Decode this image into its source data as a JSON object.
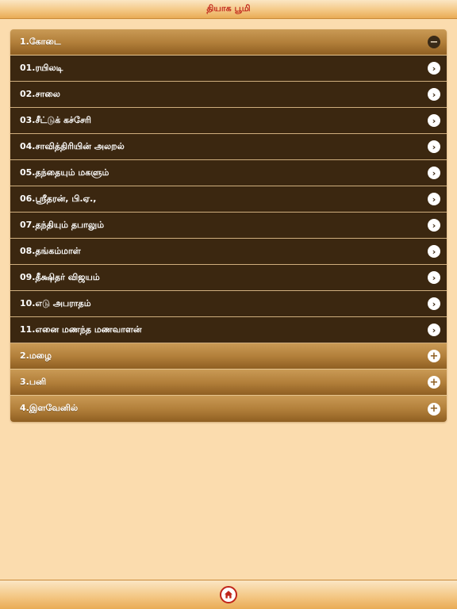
{
  "header": {
    "title": "தியாக பூமி"
  },
  "colors": {
    "title_red": "#c0251a",
    "background": "#fbdcae",
    "item_bg": "#3b2710",
    "header_gold": "#b3803b"
  },
  "sections": [
    {
      "label": "1.கோடை",
      "toggle_icon": "minus-icon",
      "expanded": true,
      "items": [
        {
          "label": "01.ரயிலடி",
          "icon": "chevron-right-icon"
        },
        {
          "label": "02.சாலை",
          "icon": "chevron-right-icon"
        },
        {
          "label": "03.சீட்டுக் கச்சேரி",
          "icon": "chevron-right-icon"
        },
        {
          "label": "04.சாவித்திரியின் அலறல்",
          "icon": "chevron-right-icon"
        },
        {
          "label": "05.தந்தையும் மகளும்",
          "icon": "chevron-right-icon"
        },
        {
          "label": "06.ஸ்ரீதரன், பி.ஏ.,",
          "icon": "chevron-right-icon"
        },
        {
          "label": "07.தந்தியும் தபாலும்",
          "icon": "chevron-right-icon"
        },
        {
          "label": "08.தங்கம்மாள்",
          "icon": "chevron-right-icon"
        },
        {
          "label": "09.தீக்ஷிதர் விஜயம்",
          "icon": "chevron-right-icon"
        },
        {
          "label": "10.எடு அபராதம்",
          "icon": "chevron-right-icon"
        },
        {
          "label": "11.எனை மணந்த மணவாளன்",
          "icon": "chevron-right-icon"
        }
      ]
    },
    {
      "label": "2.மழை",
      "toggle_icon": "plus-icon",
      "expanded": false
    },
    {
      "label": "3.பனி",
      "toggle_icon": "plus-icon",
      "expanded": false
    },
    {
      "label": "4.இளவேனில்",
      "toggle_icon": "plus-icon",
      "expanded": false
    }
  ],
  "footer": {
    "home_icon": "home-icon"
  }
}
